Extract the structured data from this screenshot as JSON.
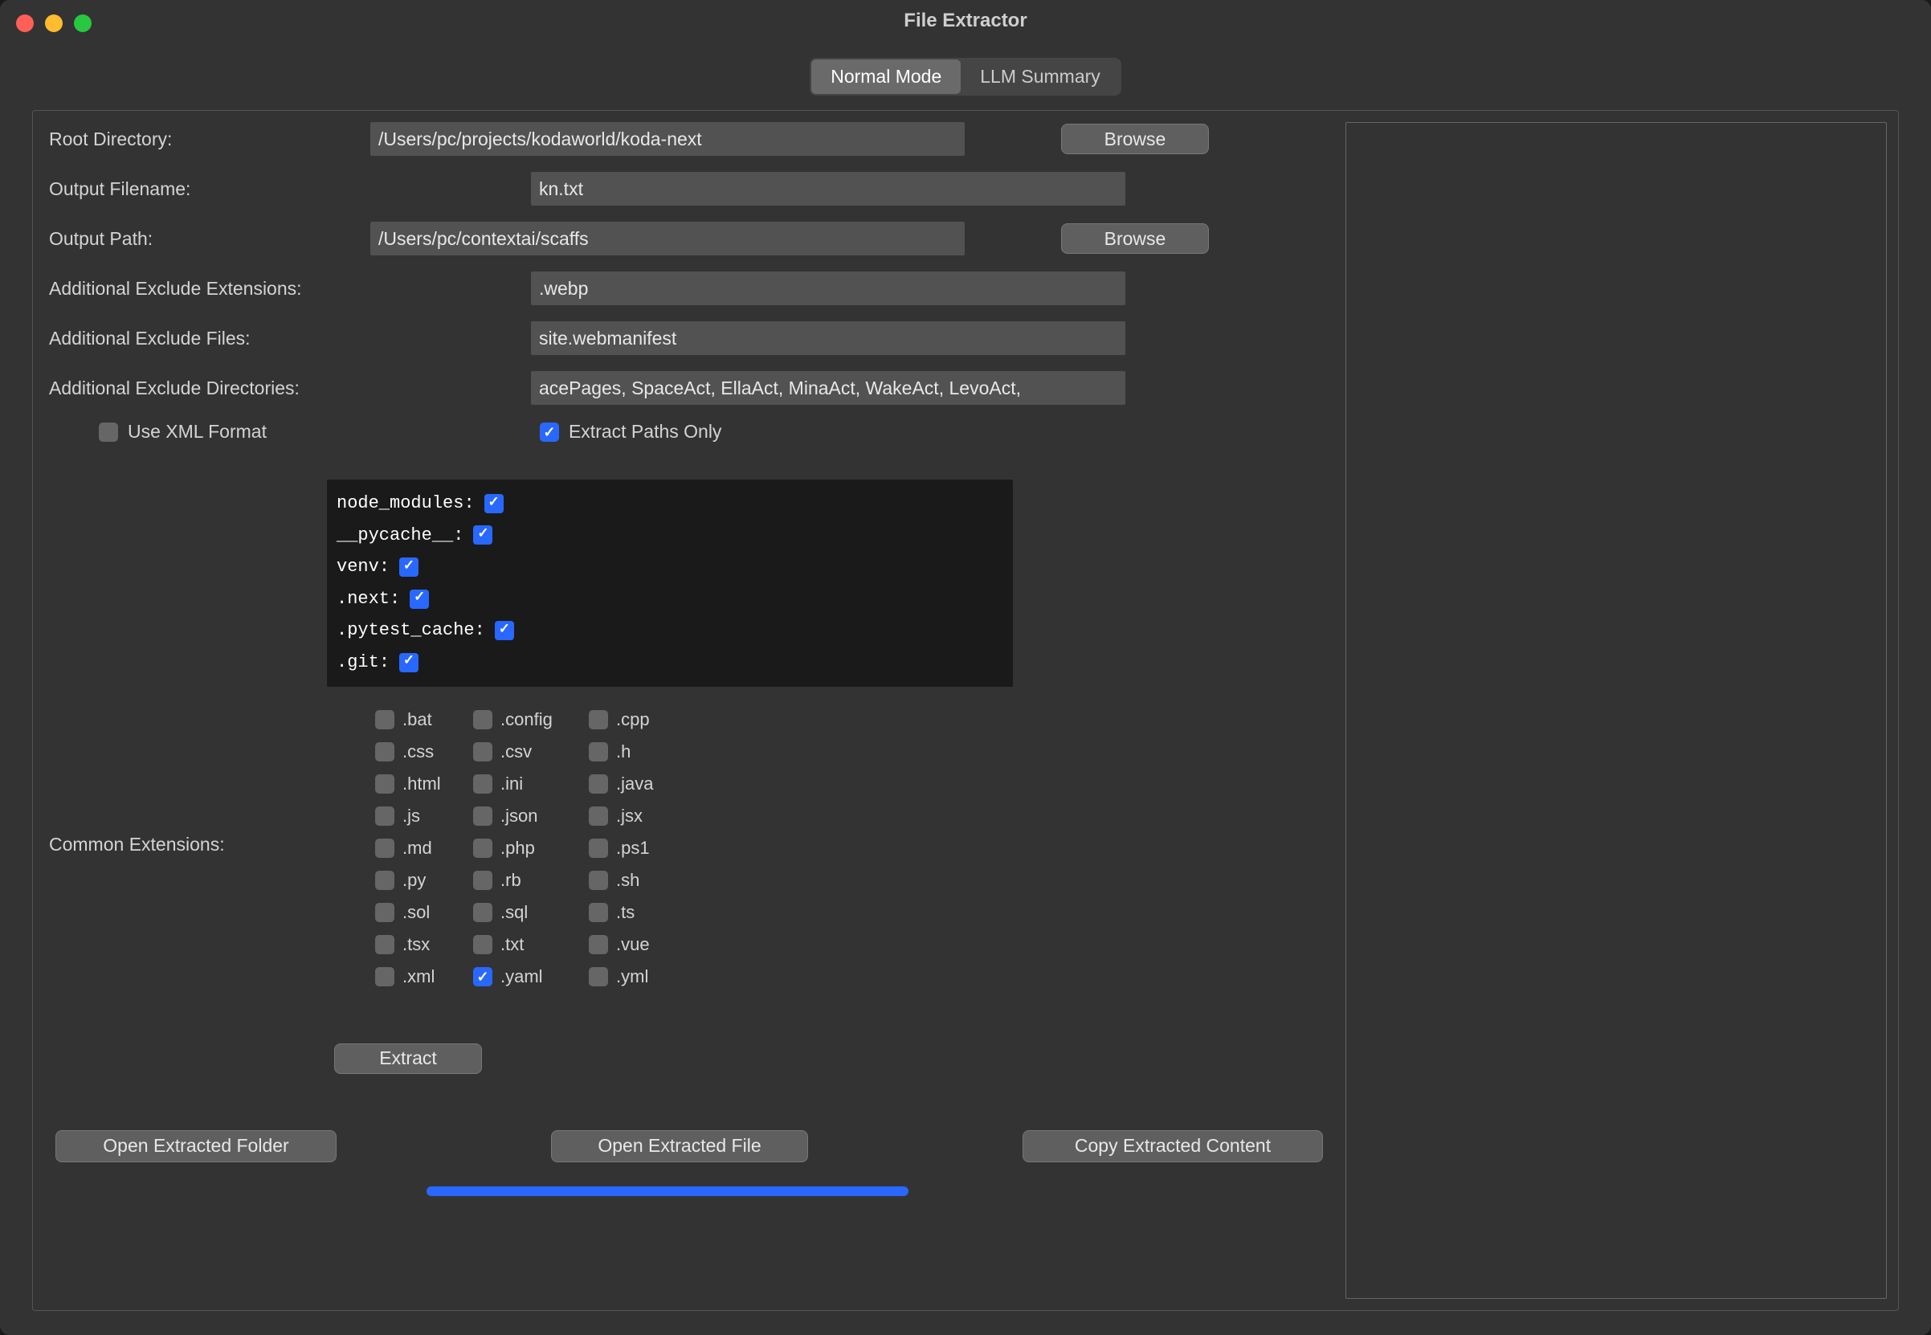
{
  "window": {
    "title": "File Extractor"
  },
  "tabs": {
    "normal": "Normal Mode",
    "llm": "LLM Summary"
  },
  "form": {
    "root_dir_label": "Root Directory:",
    "root_dir_value": "/Users/pc/projects/kodaworld/koda-next",
    "output_filename_label": "Output Filename:",
    "output_filename_value": "kn.txt",
    "output_path_label": "Output Path:",
    "output_path_value": "/Users/pc/contextai/scaffs",
    "excl_ext_label": "Additional Exclude Extensions:",
    "excl_ext_value": ".webp",
    "excl_files_label": "Additional Exclude Files:",
    "excl_files_value": "site.webmanifest",
    "excl_dirs_label": "Additional Exclude Directories:",
    "excl_dirs_value": "acePages, SpaceAct, EllaAct, MinaAct, WakeAct, LevoAct,",
    "browse_label": "Browse"
  },
  "flags": {
    "use_xml_label": "Use XML Format",
    "use_xml_checked": false,
    "extract_paths_label": "Extract Paths Only",
    "extract_paths_checked": true
  },
  "dir_checks": [
    {
      "name": "node_modules",
      "checked": true
    },
    {
      "name": "__pycache__",
      "checked": true
    },
    {
      "name": "venv",
      "checked": true
    },
    {
      "name": ".next",
      "checked": true
    },
    {
      "name": ".pytest_cache",
      "checked": true
    },
    {
      "name": ".git",
      "checked": true
    }
  ],
  "common_ext_label": "Common Extensions:",
  "extensions": [
    {
      "label": ".bat",
      "checked": false
    },
    {
      "label": ".config",
      "checked": false
    },
    {
      "label": ".cpp",
      "checked": false
    },
    {
      "label": ".css",
      "checked": false
    },
    {
      "label": ".csv",
      "checked": false
    },
    {
      "label": ".h",
      "checked": false
    },
    {
      "label": ".html",
      "checked": false
    },
    {
      "label": ".ini",
      "checked": false
    },
    {
      "label": ".java",
      "checked": false
    },
    {
      "label": ".js",
      "checked": false
    },
    {
      "label": ".json",
      "checked": false
    },
    {
      "label": ".jsx",
      "checked": false
    },
    {
      "label": ".md",
      "checked": false
    },
    {
      "label": ".php",
      "checked": false
    },
    {
      "label": ".ps1",
      "checked": false
    },
    {
      "label": ".py",
      "checked": false
    },
    {
      "label": ".rb",
      "checked": false
    },
    {
      "label": ".sh",
      "checked": false
    },
    {
      "label": ".sol",
      "checked": false
    },
    {
      "label": ".sql",
      "checked": false
    },
    {
      "label": ".ts",
      "checked": false
    },
    {
      "label": ".tsx",
      "checked": false
    },
    {
      "label": ".txt",
      "checked": false
    },
    {
      "label": ".vue",
      "checked": false
    },
    {
      "label": ".xml",
      "checked": false
    },
    {
      "label": ".yaml",
      "checked": true
    },
    {
      "label": ".yml",
      "checked": false
    }
  ],
  "buttons": {
    "extract": "Extract",
    "open_folder": "Open Extracted Folder",
    "open_file": "Open Extracted File",
    "copy_content": "Copy Extracted Content"
  }
}
